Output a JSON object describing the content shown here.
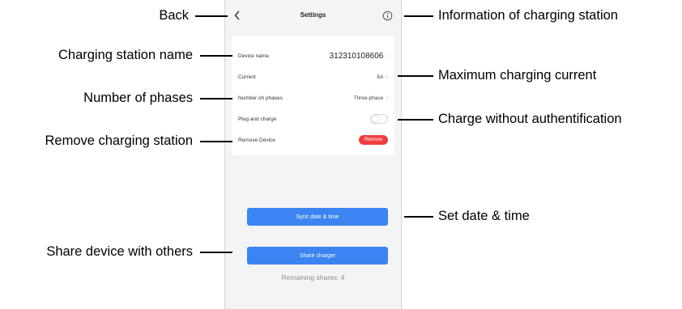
{
  "screen": {
    "title": "Settings",
    "back_icon": "chevron-left-icon",
    "info_icon": "info-circle-icon",
    "rows": {
      "device_name": {
        "label": "Device name",
        "value": "312310108606"
      },
      "current": {
        "label": "Current",
        "value": "6A"
      },
      "phases": {
        "label": "Number oh phases",
        "value": "Three-phase"
      },
      "plug_and_charge": {
        "label": "Plug and charge",
        "enabled": false
      },
      "remove_device": {
        "label": "Remove Device",
        "button_label": "Remove"
      }
    },
    "sync_button": "Sync date & time",
    "share_button": "Share charger",
    "remaining_shares": "Remaining shares: 4"
  },
  "annotations": {
    "back": "Back",
    "info": "Information of charging station",
    "station_name": "Charging station name",
    "max_current": "Maximum charging current",
    "phases": "Number of phases",
    "plug_charge": "Charge without authentification",
    "remove": "Remove charging station",
    "set_date": "Set date & time",
    "share": "Share device with others"
  },
  "colors": {
    "primary_button": "#3b84f2",
    "remove_button": "#ee3e40",
    "screen_background": "#f3f4f6"
  }
}
